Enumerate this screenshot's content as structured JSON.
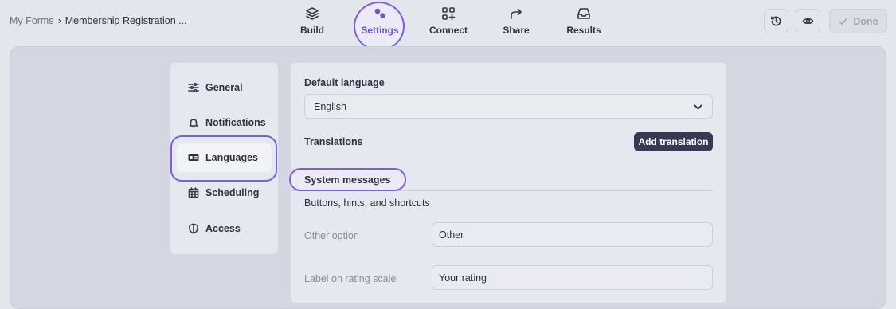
{
  "breadcrumb": {
    "root": "My Forms",
    "separator": "›",
    "current": "Membership Registration ..."
  },
  "nav": {
    "build": "Build",
    "settings": "Settings",
    "connect": "Connect",
    "share": "Share",
    "results": "Results"
  },
  "toolbar": {
    "done": "Done"
  },
  "sidebar": {
    "items": [
      {
        "label": "General",
        "icon": "sliders-icon"
      },
      {
        "label": "Notifications",
        "icon": "bell-icon"
      },
      {
        "label": "Languages",
        "icon": "language-icon"
      },
      {
        "label": "Scheduling",
        "icon": "calendar-icon"
      },
      {
        "label": "Access",
        "icon": "shield-icon"
      }
    ]
  },
  "content": {
    "default_language_label": "Default language",
    "default_language_value": "English",
    "translations_label": "Translations",
    "add_translation": "Add translation",
    "tab_system_messages": "System messages",
    "section_subtitle": "Buttons, hints, and shortcuts",
    "fields": [
      {
        "label": "Other option",
        "value": "Other"
      },
      {
        "label": "Label on rating scale",
        "value": "Your rating"
      }
    ]
  },
  "colors": {
    "accent": "#7b61d6",
    "primary_button": "#363a52",
    "background": "#e4e6ee"
  }
}
